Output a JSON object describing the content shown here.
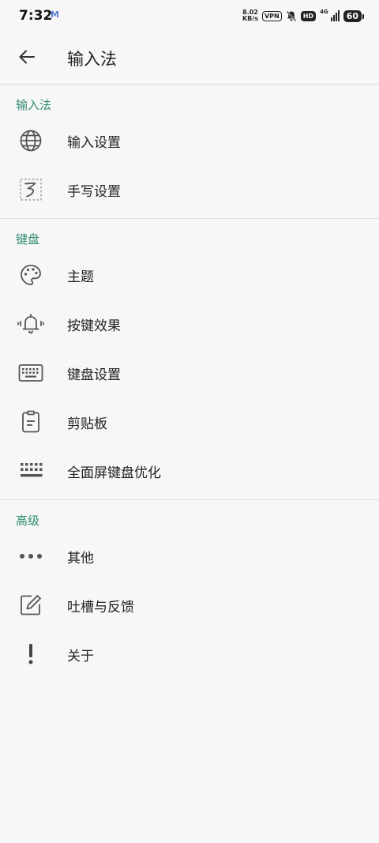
{
  "status_bar": {
    "time": "7:32",
    "mail_badge": "M",
    "net_speed_value": "8.02",
    "net_speed_unit": "KB/s",
    "vpn_label": "VPN",
    "hd_label": "HD",
    "network_type": "4G",
    "battery_level": "60"
  },
  "app_bar": {
    "title": "输入法",
    "back_icon": "arrow-left-icon"
  },
  "sections": [
    {
      "header": "输入法",
      "items": [
        {
          "label": "输入设置",
          "icon": "globe-icon"
        },
        {
          "label": "手写设置",
          "icon": "handwriting-icon"
        }
      ]
    },
    {
      "header": "键盘",
      "items": [
        {
          "label": "主题",
          "icon": "palette-icon"
        },
        {
          "label": "按键效果",
          "icon": "bell-vibrate-icon"
        },
        {
          "label": "键盘设置",
          "icon": "keyboard-icon"
        },
        {
          "label": "剪贴板",
          "icon": "clipboard-icon"
        },
        {
          "label": "全面屏键盘优化",
          "icon": "keyboard-dots-icon"
        }
      ]
    },
    {
      "header": "高级",
      "items": [
        {
          "label": "其他",
          "icon": "more-dots-icon"
        },
        {
          "label": "吐槽与反馈",
          "icon": "edit-feedback-icon"
        },
        {
          "label": "关于",
          "icon": "exclamation-icon"
        }
      ]
    }
  ],
  "colors": {
    "accent": "#2e8b73",
    "background": "#f7f7f7",
    "text": "#222222",
    "icon": "#555555"
  }
}
